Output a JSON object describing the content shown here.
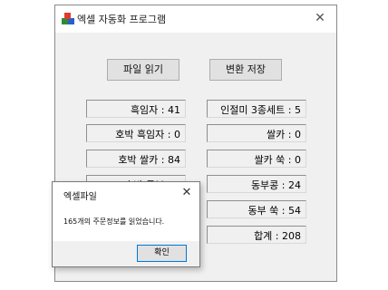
{
  "window": {
    "title": "엑셀 자동화 프로그램",
    "close_symbol": "✕"
  },
  "buttons": {
    "read_file": "파일 읽기",
    "convert_save": "변환 저장"
  },
  "fields": [
    "흑임자 : 41",
    "인절미 3종세트 : 5",
    "호박 흑임자 : 0",
    "쌀카 : 0",
    "호박 쌀카 : 84",
    "쌀카 쑥 : 0",
    "호박 동부 : 0",
    "동부콩 : 24",
    "",
    "동부 쑥 : 54",
    "",
    "합계 : 208"
  ],
  "dialog": {
    "title": "엑셀파일",
    "close_symbol": "✕",
    "message": "165개의 주문정보를 읽었습니다.",
    "ok_label": "확인"
  },
  "icons": {
    "app": "app-cubes-icon",
    "close": "close-icon"
  }
}
